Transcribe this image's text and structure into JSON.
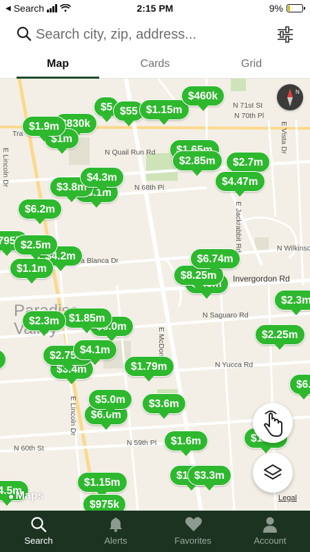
{
  "status_bar": {
    "back_label": "Search",
    "time": "2:15 PM",
    "battery": "9%"
  },
  "search": {
    "placeholder": "Search city, zip, address..."
  },
  "tabs": [
    {
      "label": "Map",
      "active": true
    },
    {
      "label": "Cards",
      "active": false
    },
    {
      "label": "Grid",
      "active": false
    }
  ],
  "map": {
    "road_labels": [
      "N 71st St",
      "N 70th Pl",
      "E Vista Dr",
      "N Quail Run Rd",
      "N 68th Pl",
      "E Lincoln Dr",
      "E Jackrabbit Rd",
      "N Wilkinson",
      "N Casa Blanca Dr",
      "Invergordon Rd",
      "N Saguaro Rd",
      "N Yucca Rd",
      "N 60th St",
      "N 59th Pl",
      "E McDonald Dr",
      "E Lincoln Dr",
      "Tra"
    ],
    "area_label": "Paradise Valley",
    "prices": [
      "$5",
      "$55",
      "$1.15m",
      "$460k",
      "$1.9m",
      "$830k",
      "$1m",
      "$1.65m",
      "$2.85m",
      "$2.7m",
      "$3.8m",
      "$4.3m",
      "$3.1m",
      "$4.47m",
      "$6.2m",
      "$795k",
      "$2.5m",
      "$1.1m",
      "$4.2m",
      "$6.74m",
      "$8.25m",
      "$3.8m",
      "$2.3m",
      "$2.3m",
      "$1.85m",
      "$3.0m",
      "$2.25m",
      "$2.75m",
      "$4.1m",
      "$3.4m",
      "$1.79m",
      "$6.",
      "$5.0m",
      "$6.0m",
      "$3.6m",
      "$1.6m",
      "$1.2m",
      "$1.2m",
      "$3.3m",
      "$1.15m",
      "$975k",
      "$4.5m",
      "$1"
    ],
    "attribution": "Maps",
    "legal": "Legal"
  },
  "bottom_nav": [
    {
      "label": "Search",
      "icon": "search-icon",
      "active": true
    },
    {
      "label": "Alerts",
      "icon": "bell-icon",
      "active": false
    },
    {
      "label": "Favorites",
      "icon": "heart-icon",
      "active": false
    },
    {
      "label": "Account",
      "icon": "person-icon",
      "active": false
    }
  ],
  "colors": {
    "pin": "#2eb82e",
    "nav_bg": "#1c3322",
    "tab_underline": "#1e4a2a",
    "map_bg": "#f3efe6"
  }
}
